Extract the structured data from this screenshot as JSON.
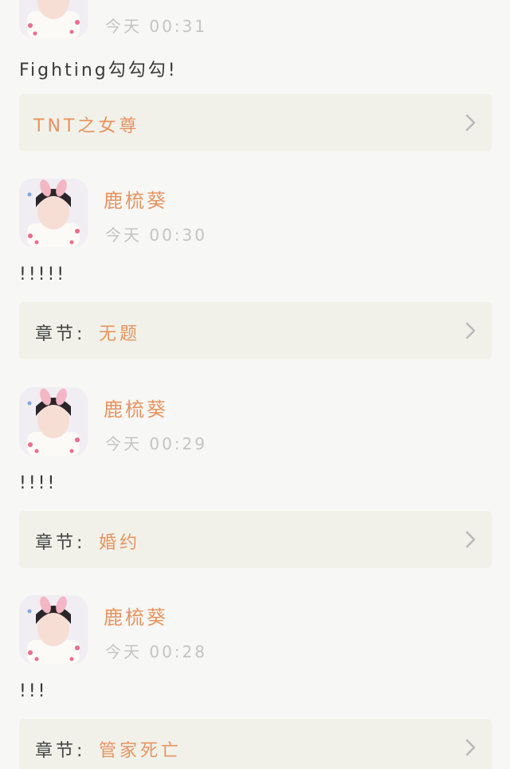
{
  "colors": {
    "accent": "#e8935e",
    "timestamp": "#c4c4c4",
    "card_bg": "#f1f1ea",
    "page_bg": "#f7f7f5"
  },
  "comments": [
    {
      "username": "",
      "timestamp": "今天 00:31",
      "text": "Fighting勾勾勾!",
      "chapter": {
        "label": "",
        "title": "TNT之女尊"
      }
    },
    {
      "username": "鹿梳葵",
      "timestamp": "今天 00:30",
      "text": "!!!!!",
      "chapter": {
        "label": "章节:",
        "title": "无题"
      }
    },
    {
      "username": "鹿梳葵",
      "timestamp": "今天 00:29",
      "text": "!!!!",
      "chapter": {
        "label": "章节:",
        "title": "婚约"
      }
    },
    {
      "username": "鹿梳葵",
      "timestamp": "今天 00:28",
      "text": "!!!",
      "chapter": {
        "label": "章节:",
        "title": "管家死亡"
      }
    }
  ]
}
